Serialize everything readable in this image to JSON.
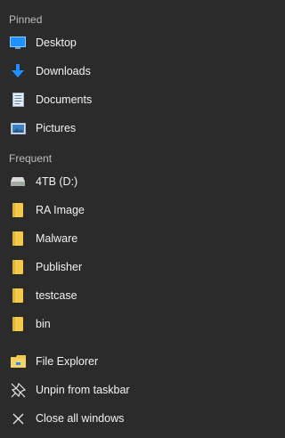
{
  "pinned": {
    "header": "Pinned",
    "items": [
      {
        "label": "Desktop",
        "icon": "desktop-icon"
      },
      {
        "label": "Downloads",
        "icon": "download-arrow-icon"
      },
      {
        "label": "Documents",
        "icon": "document-icon"
      },
      {
        "label": "Pictures",
        "icon": "pictures-icon"
      }
    ]
  },
  "frequent": {
    "header": "Frequent",
    "items": [
      {
        "label": "4TB (D:)",
        "icon": "drive-icon"
      },
      {
        "label": "RA Image",
        "icon": "folder-icon"
      },
      {
        "label": "Malware",
        "icon": "folder-icon"
      },
      {
        "label": "Publisher",
        "icon": "folder-icon"
      },
      {
        "label": "testcase",
        "icon": "folder-icon"
      },
      {
        "label": "bin",
        "icon": "folder-icon"
      }
    ]
  },
  "tasks": {
    "items": [
      {
        "label": "File Explorer",
        "icon": "file-explorer-icon"
      },
      {
        "label": "Unpin from taskbar",
        "icon": "unpin-icon"
      },
      {
        "label": "Close all windows",
        "icon": "close-icon"
      }
    ]
  },
  "colors": {
    "background": "#2b2b2b",
    "folder": "#f3c94a",
    "accent_blue": "#1e90ff"
  }
}
